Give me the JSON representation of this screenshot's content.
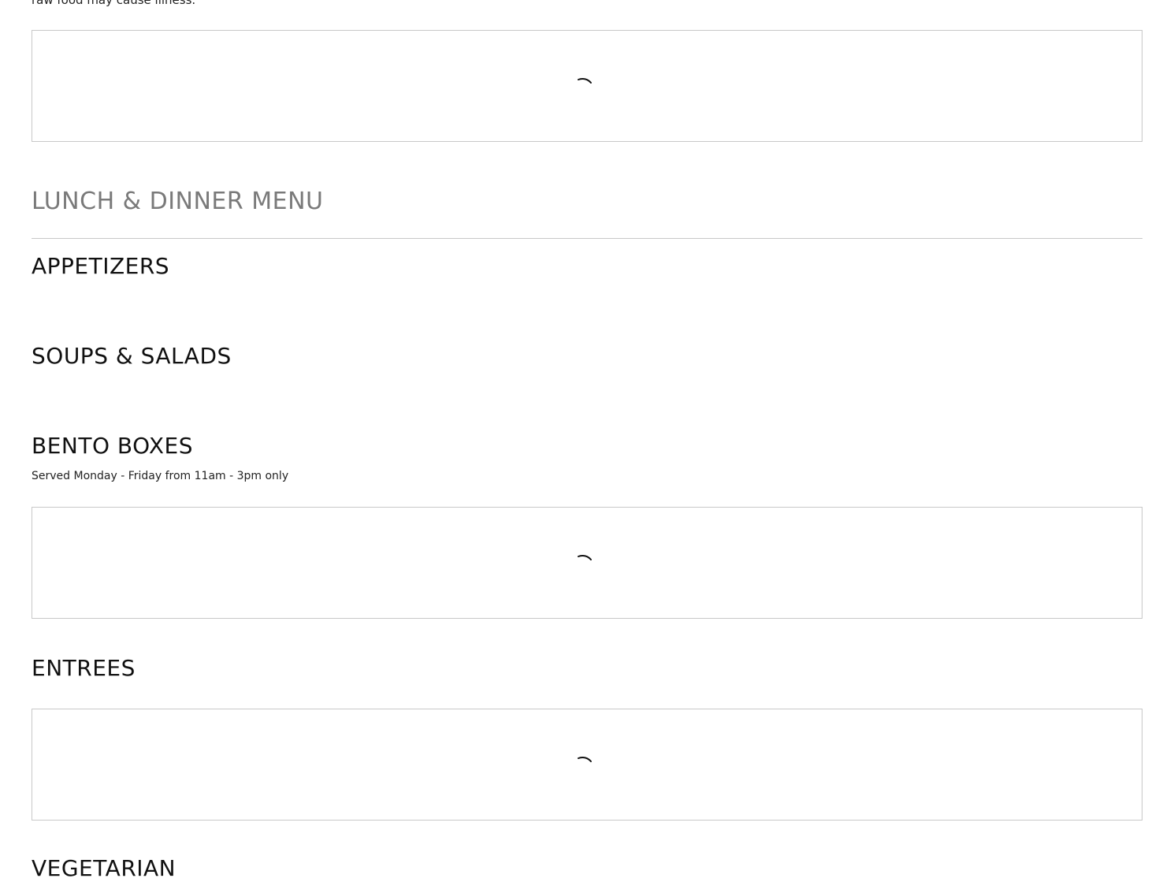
{
  "disclaimer": "raw food may cause illness.",
  "menu": {
    "title": "LUNCH & DINNER MENU",
    "sections": [
      {
        "title": "APPETIZERS",
        "note": ""
      },
      {
        "title": "SOUPS & SALADS",
        "note": ""
      },
      {
        "title": "BENTO BOXES",
        "note": "Served Monday - Friday from 11am - 3pm only"
      },
      {
        "title": "ENTREES",
        "note": ""
      },
      {
        "title": "VEGETARIAN",
        "note": ""
      }
    ]
  },
  "icons": {
    "loader": "loading-spinner-icon"
  },
  "colors": {
    "title_gray": "#7a7a7a",
    "border_gray": "#c8c8c8"
  }
}
